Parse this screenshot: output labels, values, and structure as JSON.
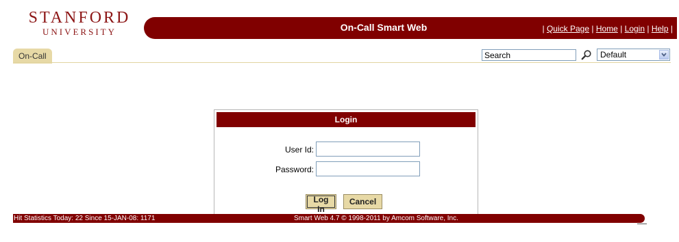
{
  "header": {
    "logo_main": "STANFORD",
    "logo_sub": "UNIVERSITY",
    "app_title": "On-Call Smart Web",
    "links": [
      "Quick Page",
      "Home",
      "Login",
      "Help"
    ],
    "separator": "|"
  },
  "toolbar": {
    "tab_label": "On-Call",
    "search_value": "Search",
    "select_value": "Default"
  },
  "login": {
    "title": "Login",
    "user_id_label": "User Id:",
    "password_label": "Password:",
    "login_button": "Log In",
    "cancel_button": "Cancel"
  },
  "footer": {
    "stats": "Hit Statistics Today: 22 Since 15-JAN-08: 1171",
    "copyright": "Smart Web 4.7 © 1998-2011 by Amcom Software, Inc."
  },
  "colors": {
    "brand": "#800000",
    "tab": "#e7d9a6"
  }
}
